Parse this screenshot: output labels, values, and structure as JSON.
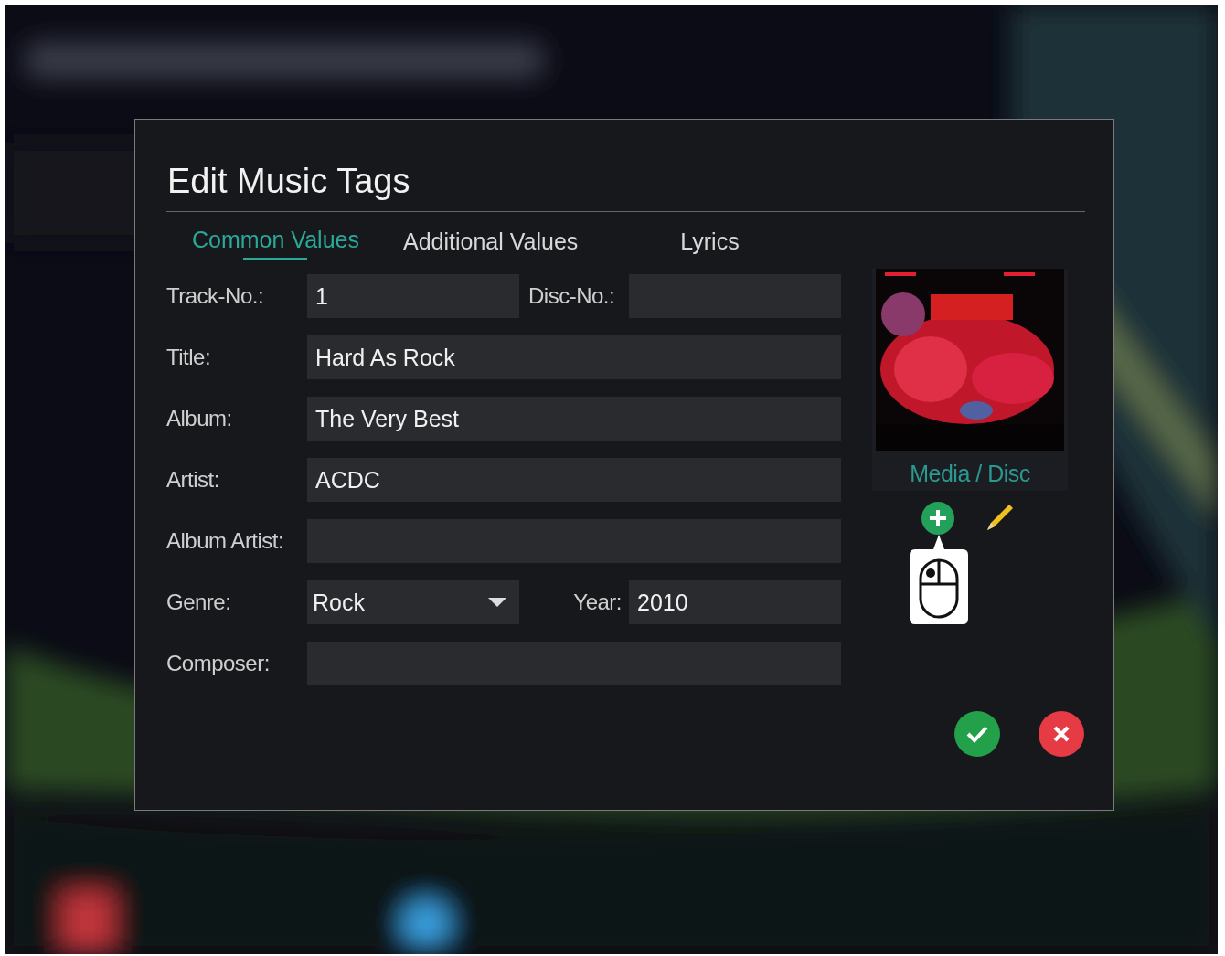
{
  "dialog": {
    "title": "Edit Music Tags"
  },
  "tabs": [
    {
      "label": "Common Values",
      "selected": true
    },
    {
      "label": "Additional Values",
      "selected": false
    },
    {
      "label": "Lyrics",
      "selected": false
    }
  ],
  "rows": [
    {
      "fields": [
        {
          "label": "Track-No.:",
          "value": "1",
          "kind": "text"
        },
        {
          "label": "Disc-No.:",
          "kind": "text"
        }
      ]
    },
    {
      "fields": [
        {
          "label": "Title:",
          "value": "Hard As Rock",
          "kind": "text"
        }
      ]
    },
    {
      "fields": [
        {
          "label": "Album:",
          "value": "The Very Best",
          "kind": "text"
        }
      ]
    },
    {
      "fields": [
        {
          "label": "Artist:",
          "value": "ACDC",
          "kind": "text"
        }
      ]
    },
    {
      "fields": [
        {
          "label": "Album Artist:",
          "kind": "text"
        }
      ]
    },
    {
      "fields": [
        {
          "label": "Genre:",
          "value": "Rock",
          "kind": "dropdown"
        },
        {
          "label": "Year:",
          "value": "2010",
          "kind": "text"
        }
      ]
    },
    {
      "fields": [
        {
          "label": "Composer:",
          "kind": "text"
        }
      ]
    }
  ],
  "cover": {
    "kind": "picture",
    "caption": "Media / Disc"
  }
}
